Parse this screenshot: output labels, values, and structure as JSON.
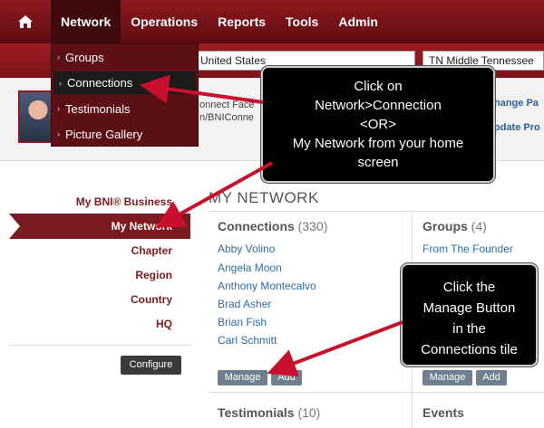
{
  "nav": {
    "items": [
      "Network",
      "Operations",
      "Reports",
      "Tools",
      "Admin"
    ],
    "active": "Network"
  },
  "subbar": {
    "country": "United States",
    "region": "TN Middle Tennessee"
  },
  "dropdown": {
    "items": [
      "Groups",
      "Connections",
      "Testimonials",
      "Picture Gallery"
    ]
  },
  "profile": {
    "line1": "onnect Face",
    "line2": "n/BNIConne",
    "link1": "hange Pa",
    "link2": "pdate Pro"
  },
  "sidebar": {
    "items": [
      "My BNI® Business",
      "My Network",
      "Chapter",
      "Region",
      "Country",
      "HQ"
    ],
    "configure": "Configure"
  },
  "main": {
    "title": "MY NETWORK",
    "connections": {
      "label": "Connections",
      "count": "(330)",
      "names": [
        "Abby Volino",
        "Angela Moon",
        "Anthony Montecalvo",
        "Brad Asher",
        "Brian Fish",
        "Carl Schmitt"
      ],
      "manage": "Manage",
      "add": "Add"
    },
    "groups": {
      "label": "Groups",
      "count": "(4)",
      "names": [
        "From The Founder"
      ],
      "manage": "Manage",
      "add": "Add"
    },
    "testimonials": {
      "label": "Testimonials",
      "count": "(10)"
    },
    "events": {
      "label": "Events"
    }
  },
  "callouts": {
    "first": [
      "Click on",
      "Network>Connection",
      "<OR>",
      "My Network from your home",
      "screen"
    ],
    "second": [
      "Click the",
      "Manage Button",
      "in the",
      "Connections tile"
    ]
  },
  "colors": {
    "nav_red": "#8f1820",
    "sidebar_active": "#7b1a20",
    "link_blue": "#2b6da8",
    "arrow_red": "#c8102e"
  }
}
